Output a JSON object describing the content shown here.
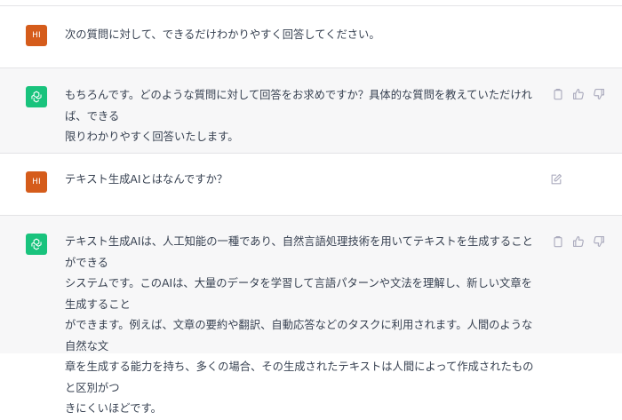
{
  "conversation": {
    "messages": [
      {
        "role": "user",
        "avatar_label": "HI",
        "text": "次の質問に対して、できるだけわかりやすく回答してください。"
      },
      {
        "role": "assistant",
        "avatar_icon": "openai-logo-icon",
        "text": "もちろんです。どのような質問に対して回答をお求めですか？具体的な質問を教えていただければ、できる\n限りわかりやすく回答いたします。"
      },
      {
        "role": "user",
        "avatar_label": "HI",
        "text": "テキスト生成AIとはなんですか？"
      },
      {
        "role": "assistant",
        "avatar_icon": "openai-logo-icon",
        "text": "テキスト生成AIは、人工知能の一種であり、自然言語処理技術を用いてテキストを生成することができる\nシステムです。このAIは、大量のデータを学習して言語パターンや文法を理解し、新しい文章を生成すること\nができます。例えば、文章の要約や翻訳、自動応答などのタスクに利用されます。人間のような自然な文\n章を生成する能力を持ち、多くの場合、その生成されたテキストは人間によって作成されたものと区別がつ\nきにくいほどです。"
      }
    ]
  },
  "icons": {
    "copy": "copy-icon",
    "thumbs_up": "thumbs-up-icon",
    "thumbs_down": "thumbs-down-icon",
    "edit": "edit-icon"
  },
  "colors": {
    "user_avatar": "#d55c1b",
    "assistant_avatar": "#19c37d",
    "assistant_bg": "#f7f7f8",
    "icon_gray": "#acacbe"
  }
}
